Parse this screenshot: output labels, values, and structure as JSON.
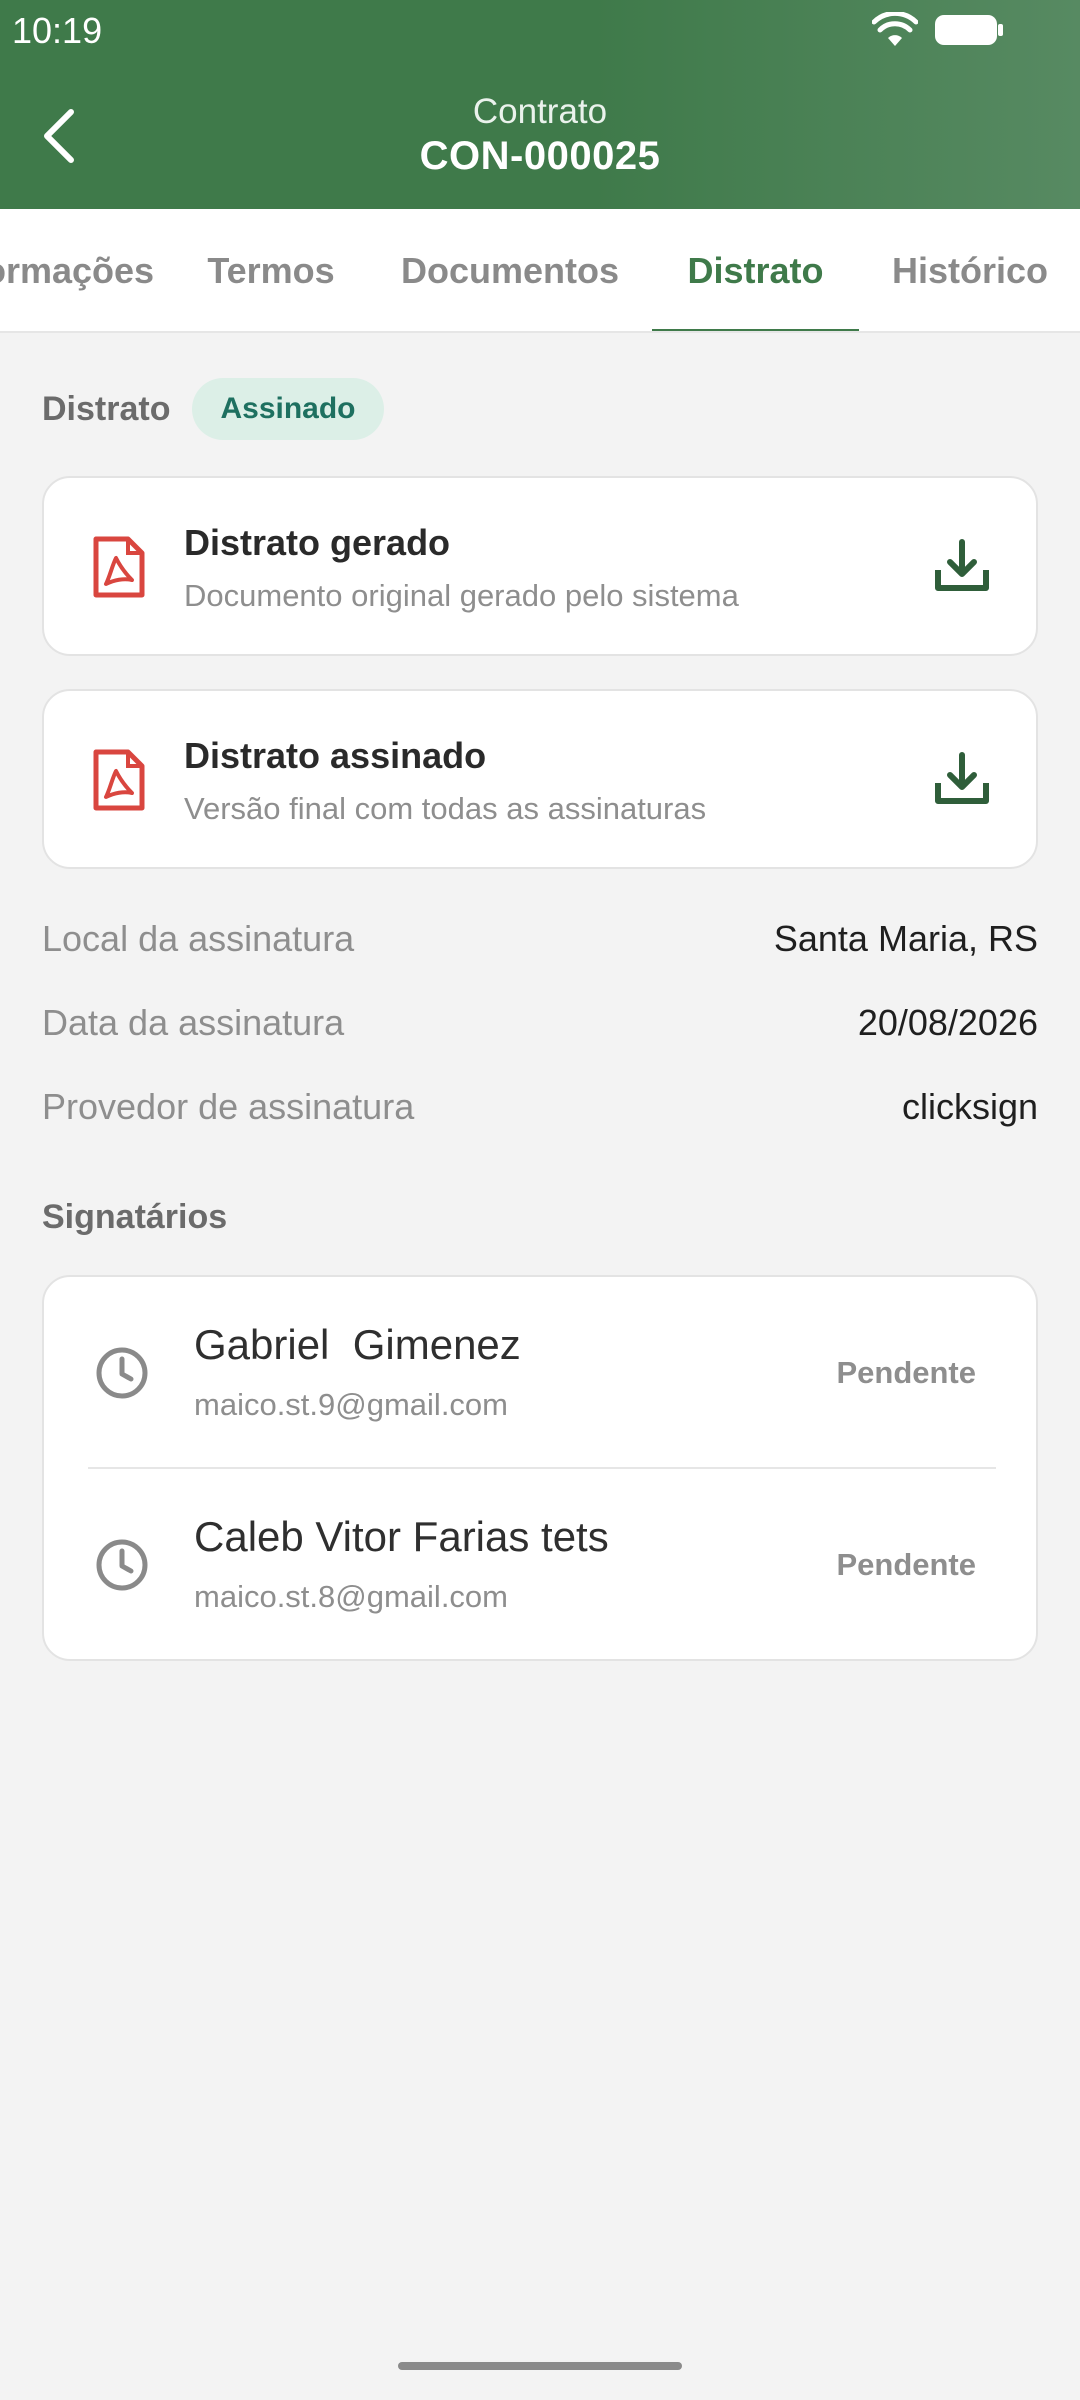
{
  "status_bar": {
    "time": "10:19",
    "icons": [
      "wifi-icon",
      "battery-icon"
    ]
  },
  "header": {
    "subtitle": "Contrato",
    "title": "CON-000025",
    "back_icon": "chevron-left-icon"
  },
  "tabs": [
    {
      "label": "Informações"
    },
    {
      "label": "Termos"
    },
    {
      "label": "Documentos"
    },
    {
      "label": "Distrato",
      "active": true
    },
    {
      "label": "Histórico"
    }
  ],
  "section": {
    "label": "Distrato",
    "badge": "Assinado"
  },
  "documents": [
    {
      "title": "Distrato gerado",
      "description": "Documento original gerado pelo sistema",
      "icon": "pdf-icon",
      "action_icon": "download-icon"
    },
    {
      "title": "Distrato assinado",
      "description": "Versão final com todas as assinaturas",
      "icon": "pdf-icon",
      "action_icon": "download-icon"
    }
  ],
  "details": [
    {
      "label": "Local da assinatura",
      "value": "Santa Maria, RS"
    },
    {
      "label": "Data da assinatura",
      "value": "20/08/2026"
    },
    {
      "label": "Provedor de assinatura",
      "value": "clicksign"
    }
  ],
  "signers_title": "Signatários",
  "signers": [
    {
      "name": "Gabriel  Gimenez",
      "email": "maico.st.9@gmail.com",
      "status": "Pendente",
      "icon": "clock-icon"
    },
    {
      "name": "Caleb Vitor Farias tets",
      "email": "maico.st.8@gmail.com",
      "status": "Pendente",
      "icon": "clock-icon"
    }
  ],
  "colors": {
    "brand_green": "#3f7a4a",
    "badge_bg": "#dcefe7",
    "badge_text": "#1e7060",
    "pdf_red": "#d9463f",
    "download_green": "#2f5e3a"
  }
}
